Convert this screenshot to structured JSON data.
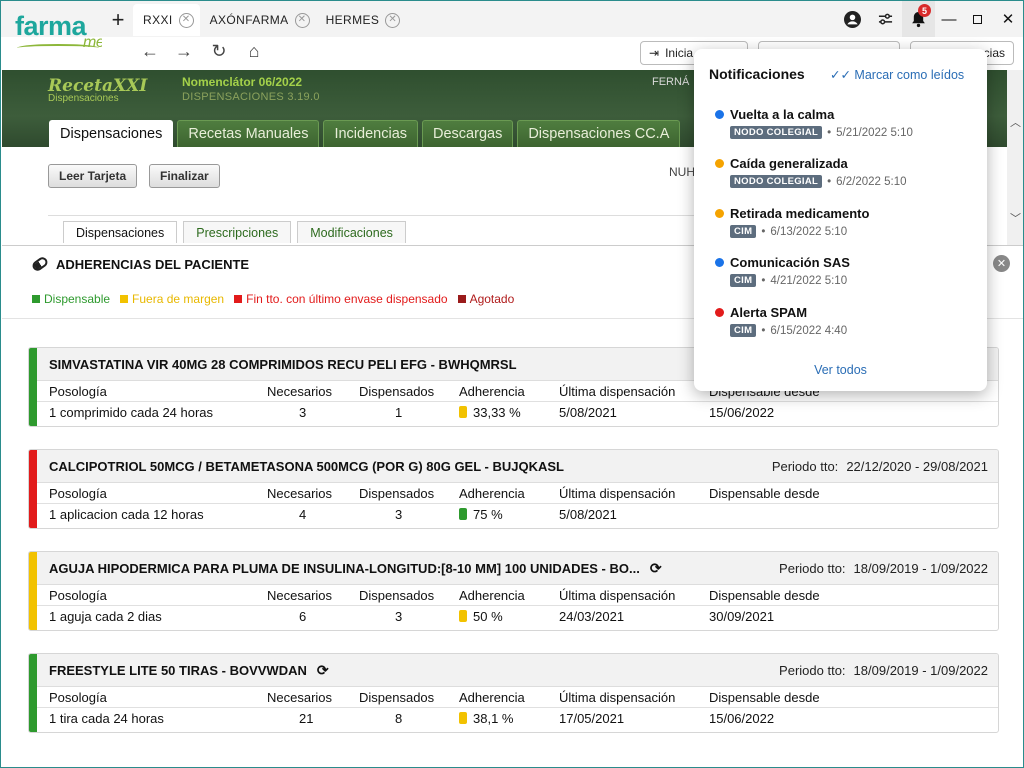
{
  "browser": {
    "logo_text": "farma",
    "logo_sub": "me",
    "tabs": [
      {
        "label": "RXXI"
      },
      {
        "label": "AXÓNFARMA"
      },
      {
        "label": "HERMES"
      }
    ],
    "new_tab_glyph": "+",
    "notif_count": "5",
    "pills": {
      "login": "Inicia",
      "other": "cias"
    },
    "icons": [
      "account-icon",
      "settings-sliders-icon",
      "bell-icon",
      "minimize-icon",
      "maximize-icon",
      "close-icon",
      "back-icon",
      "forward-icon",
      "reload-icon",
      "home-icon"
    ]
  },
  "app": {
    "logo": "RecetaXXI",
    "logo_sub": "Dispensaciones",
    "nomenclator": "Nomenclátor 06/2022",
    "version": "DISPENSACIONES 3.19.0",
    "user": "FERNÁ",
    "tabs": [
      "Dispensaciones",
      "Recetas Manuales",
      "Incidencias",
      "Descargas",
      "Dispensaciones CC.A"
    ],
    "buttons": {
      "read_card": "Leer Tarjeta",
      "finish": "Finalizar"
    },
    "nuh": "NUH",
    "subtabs": [
      "Dispensaciones",
      "Prescripciones",
      "Modificaciones"
    ]
  },
  "panel": {
    "title": "ADHERENCIAS DEL PACIENTE",
    "legend": [
      {
        "label": "Dispensable",
        "color": "#2e9a2e"
      },
      {
        "label": "Fuera de margen",
        "color": "#f2c200"
      },
      {
        "label": "Fin tto. con último envase dispensado",
        "color": "#e21b1b"
      },
      {
        "label": "Agotado",
        "color": "#9a1b1b"
      }
    ],
    "headers": {
      "posologia": "Posología",
      "necesarios": "Necesarios",
      "dispensados": "Dispensados",
      "adherencia": "Adherencia",
      "ultima": "Última dispensación",
      "desde": "Dispensable desde"
    },
    "periodo_label": "Periodo tto:",
    "cards": [
      {
        "title": "SIMVASTATINA VIR 40MG 28 COMPRIMIDOS RECU PELI EFG - BWHQMRSL",
        "color": "#2e9a2e",
        "periodo": "",
        "posologia": "1 comprimido cada 24 horas",
        "necesarios": "3",
        "dispensados": "1",
        "adherencia": "33,33 %",
        "battery_color": "#f2c200",
        "ultima": "5/08/2021",
        "desde": "15/06/2022",
        "refresh": false
      },
      {
        "title": "CALCIPOTRIOL 50MCG / BETAMETASONA 500MCG (POR G) 80G GEL - BUJQKASL",
        "color": "#e21b1b",
        "periodo": "22/12/2020 - 29/08/2021",
        "posologia": "1 aplicacion cada 12 horas",
        "necesarios": "4",
        "dispensados": "3",
        "adherencia": "75 %",
        "battery_color": "#2e9a2e",
        "ultima": "5/08/2021",
        "desde": "",
        "refresh": false
      },
      {
        "title": "AGUJA HIPODERMICA PARA PLUMA DE INSULINA-LONGITUD:[8-10 MM] 100 UNIDADES - BO...",
        "color": "#f2c200",
        "periodo": "18/09/2019 - 1/09/2022",
        "posologia": "1 aguja cada 2 dias",
        "necesarios": "6",
        "dispensados": "3",
        "adherencia": "50 %",
        "battery_color": "#f2c200",
        "ultima": "24/03/2021",
        "desde": "30/09/2021",
        "refresh": true
      },
      {
        "title": "FREESTYLE LITE 50 TIRAS - BOVVWDAN",
        "color": "#2e9a2e",
        "periodo": "18/09/2019 - 1/09/2022",
        "posologia": "1 tira cada 24 horas",
        "necesarios": "21",
        "dispensados": "8",
        "adherencia": "38,1 %",
        "battery_color": "#f2c200",
        "ultima": "17/05/2021",
        "desde": "15/06/2022",
        "refresh": true
      }
    ]
  },
  "notifications": {
    "title": "Notificaciones",
    "mark_read": "Marcar como leídos",
    "see_all": "Ver todos",
    "items": [
      {
        "title": "Vuelta a la calma",
        "dot": "#1a73e8",
        "tag": "NODO COLEGIAL",
        "date": "5/21/2022 5:10"
      },
      {
        "title": "Caída generalizada",
        "dot": "#f5a300",
        "tag": "NODO COLEGIAL",
        "date": "6/2/2022 5:10"
      },
      {
        "title": "Retirada medicamento",
        "dot": "#f5a300",
        "tag": "CIM",
        "date": "6/13/2022 5:10"
      },
      {
        "title": "Comunicación SAS",
        "dot": "#1a73e8",
        "tag": "CIM",
        "date": "4/21/2022 5:10"
      },
      {
        "title": "Alerta SPAM",
        "dot": "#e21b1b",
        "tag": "CIM",
        "date": "6/15/2022 4:40"
      }
    ]
  }
}
